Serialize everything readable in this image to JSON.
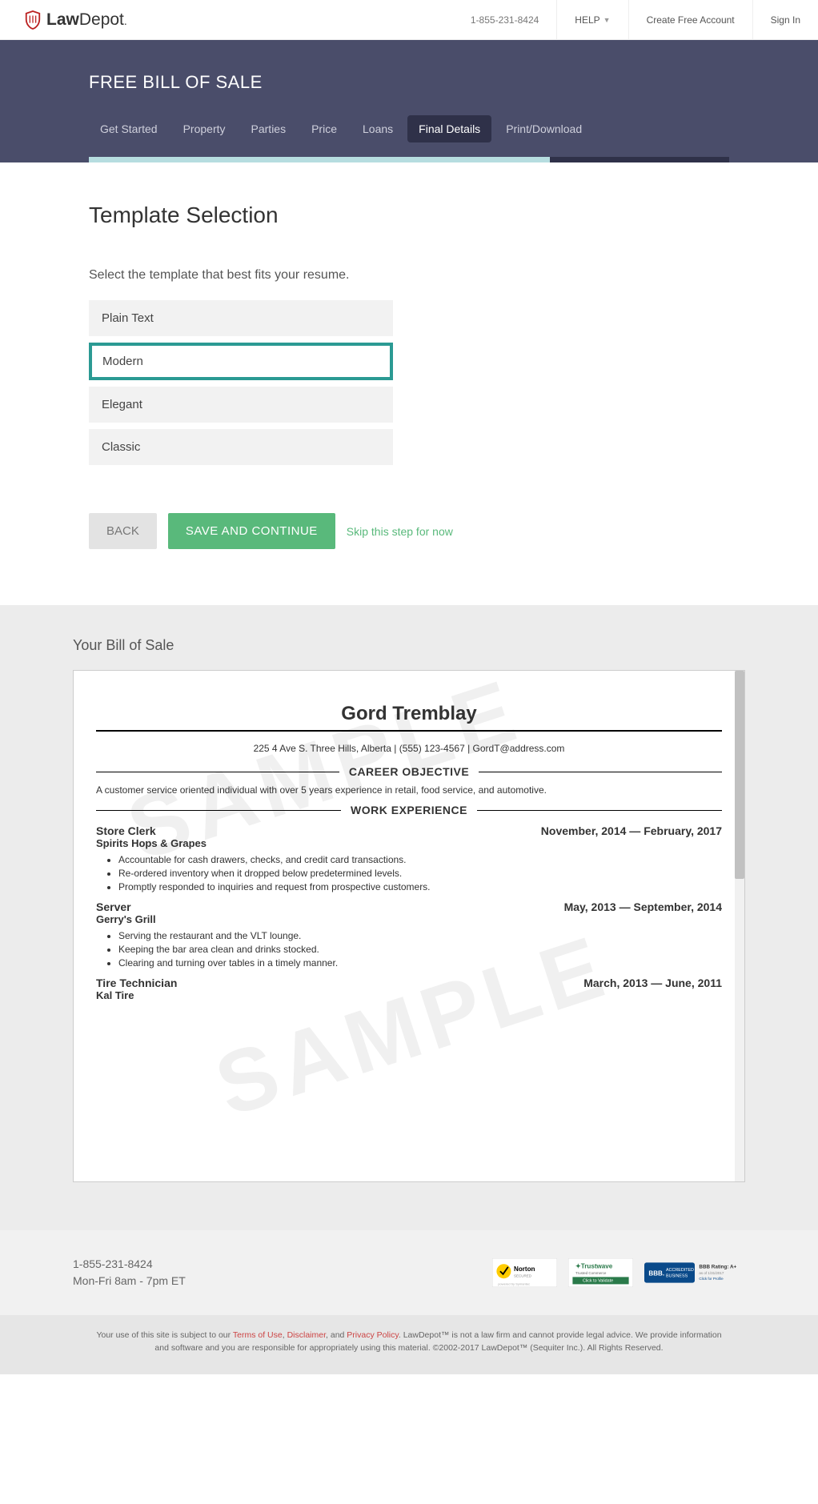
{
  "header": {
    "logo_bold": "Law",
    "logo_light": "Depot",
    "phone": "1-855-231-8424",
    "help": "HELP",
    "create_account": "Create Free Account",
    "sign_in": "Sign In"
  },
  "hero": {
    "title": "FREE BILL OF SALE",
    "tabs": [
      {
        "label": "Get Started",
        "active": false
      },
      {
        "label": "Property",
        "active": false
      },
      {
        "label": "Parties",
        "active": false
      },
      {
        "label": "Price",
        "active": false
      },
      {
        "label": "Loans",
        "active": false
      },
      {
        "label": "Final Details",
        "active": true
      },
      {
        "label": "Print/Download",
        "active": false
      }
    ],
    "progress_pct": 72
  },
  "content": {
    "title": "Template Selection",
    "subtitle": "Select the template that best fits your resume.",
    "options": [
      {
        "label": "Plain Text",
        "selected": false
      },
      {
        "label": "Modern",
        "selected": true
      },
      {
        "label": "Elegant",
        "selected": false
      },
      {
        "label": "Classic",
        "selected": false
      }
    ],
    "back_btn": "BACK",
    "save_btn": "SAVE AND CONTINUE",
    "skip_link": "Skip this step for now"
  },
  "preview": {
    "title": "Your Bill of Sale",
    "watermark": "SAMPLE",
    "doc": {
      "name": "Gord Tremblay",
      "contact": "225 4 Ave S. Three Hills, Alberta  |  (555) 123-4567  |  GordT@address.com",
      "objective_head": "CAREER OBJECTIVE",
      "objective_text": "A customer service oriented individual with over 5 years experience in retail, food service, and automotive.",
      "work_head": "WORK EXPERIENCE",
      "jobs": [
        {
          "title": "Store Clerk",
          "dates": "November, 2014 — February, 2017",
          "subtitle": "Spirits Hops & Grapes",
          "bullets": [
            "Accountable for cash drawers, checks, and credit card transactions.",
            "Re-ordered inventory when it dropped below predetermined levels.",
            "Promptly responded to inquiries and request from prospective customers."
          ]
        },
        {
          "title": "Server",
          "dates": "May, 2013 — September, 2014",
          "subtitle": "Gerry's Grill",
          "bullets": [
            "Serving the restaurant and the VLT lounge.",
            "Keeping the bar area clean and drinks stocked.",
            "Clearing and turning over tables in a timely manner."
          ]
        },
        {
          "title": "Tire Technician",
          "dates": "March, 2013 — June, 2011",
          "subtitle": "Kal Tire",
          "bullets": []
        }
      ]
    }
  },
  "footer": {
    "phone": "1-855-231-8424",
    "hours": "Mon-Fri 8am - 7pm ET",
    "legal_pre": "Your use of this site is subject to our ",
    "terms": "Terms of Use",
    "disclaimer": "Disclaimer",
    "privacy": "Privacy Policy",
    "legal_mid": ". LawDepot™ is not a law firm and cannot provide legal advice. We provide information and software and you are responsible for appropriately using this material. ©2002-2017 LawDepot™ (Sequiter Inc.). All Rights Reserved."
  }
}
